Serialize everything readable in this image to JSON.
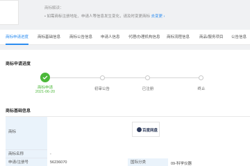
{
  "tip": {
    "label": "商标解读：",
    "text": "• 如需商标注册地址、申请人等信息发生变化，请及时变更商标",
    "link": "去变更 ›"
  },
  "tabs": [
    {
      "label": "商标申请进度",
      "active": true
    },
    {
      "label": "商标基础信息"
    },
    {
      "label": "商标公告信息"
    },
    {
      "label": "申请人信息"
    },
    {
      "label": "代理/办理机构信息"
    },
    {
      "label": "商标流程信息"
    },
    {
      "label": "商品/服务项目"
    },
    {
      "label": "公告信息"
    }
  ],
  "progress": {
    "title": "商标申请进度",
    "steps": [
      {
        "label": "商标申请",
        "date": "2021-06-20",
        "done": true
      },
      {
        "label": "初审公告"
      },
      {
        "label": "已注册"
      },
      {
        "label": "终止"
      }
    ]
  },
  "basic": {
    "title": "商标基础信息",
    "rows": {
      "image_label": "商标",
      "name_label": "商标名称",
      "name_value": "-",
      "reg_label": "申请/注册号",
      "reg_value": "56236070",
      "class_label": "国际分类",
      "class_value": "09-科学仪器"
    },
    "brand_text": "百度网盘"
  },
  "colors": {
    "accent": "#2b8cf0",
    "success": "#4cb83a",
    "label_bg": "#eaf3fb"
  }
}
